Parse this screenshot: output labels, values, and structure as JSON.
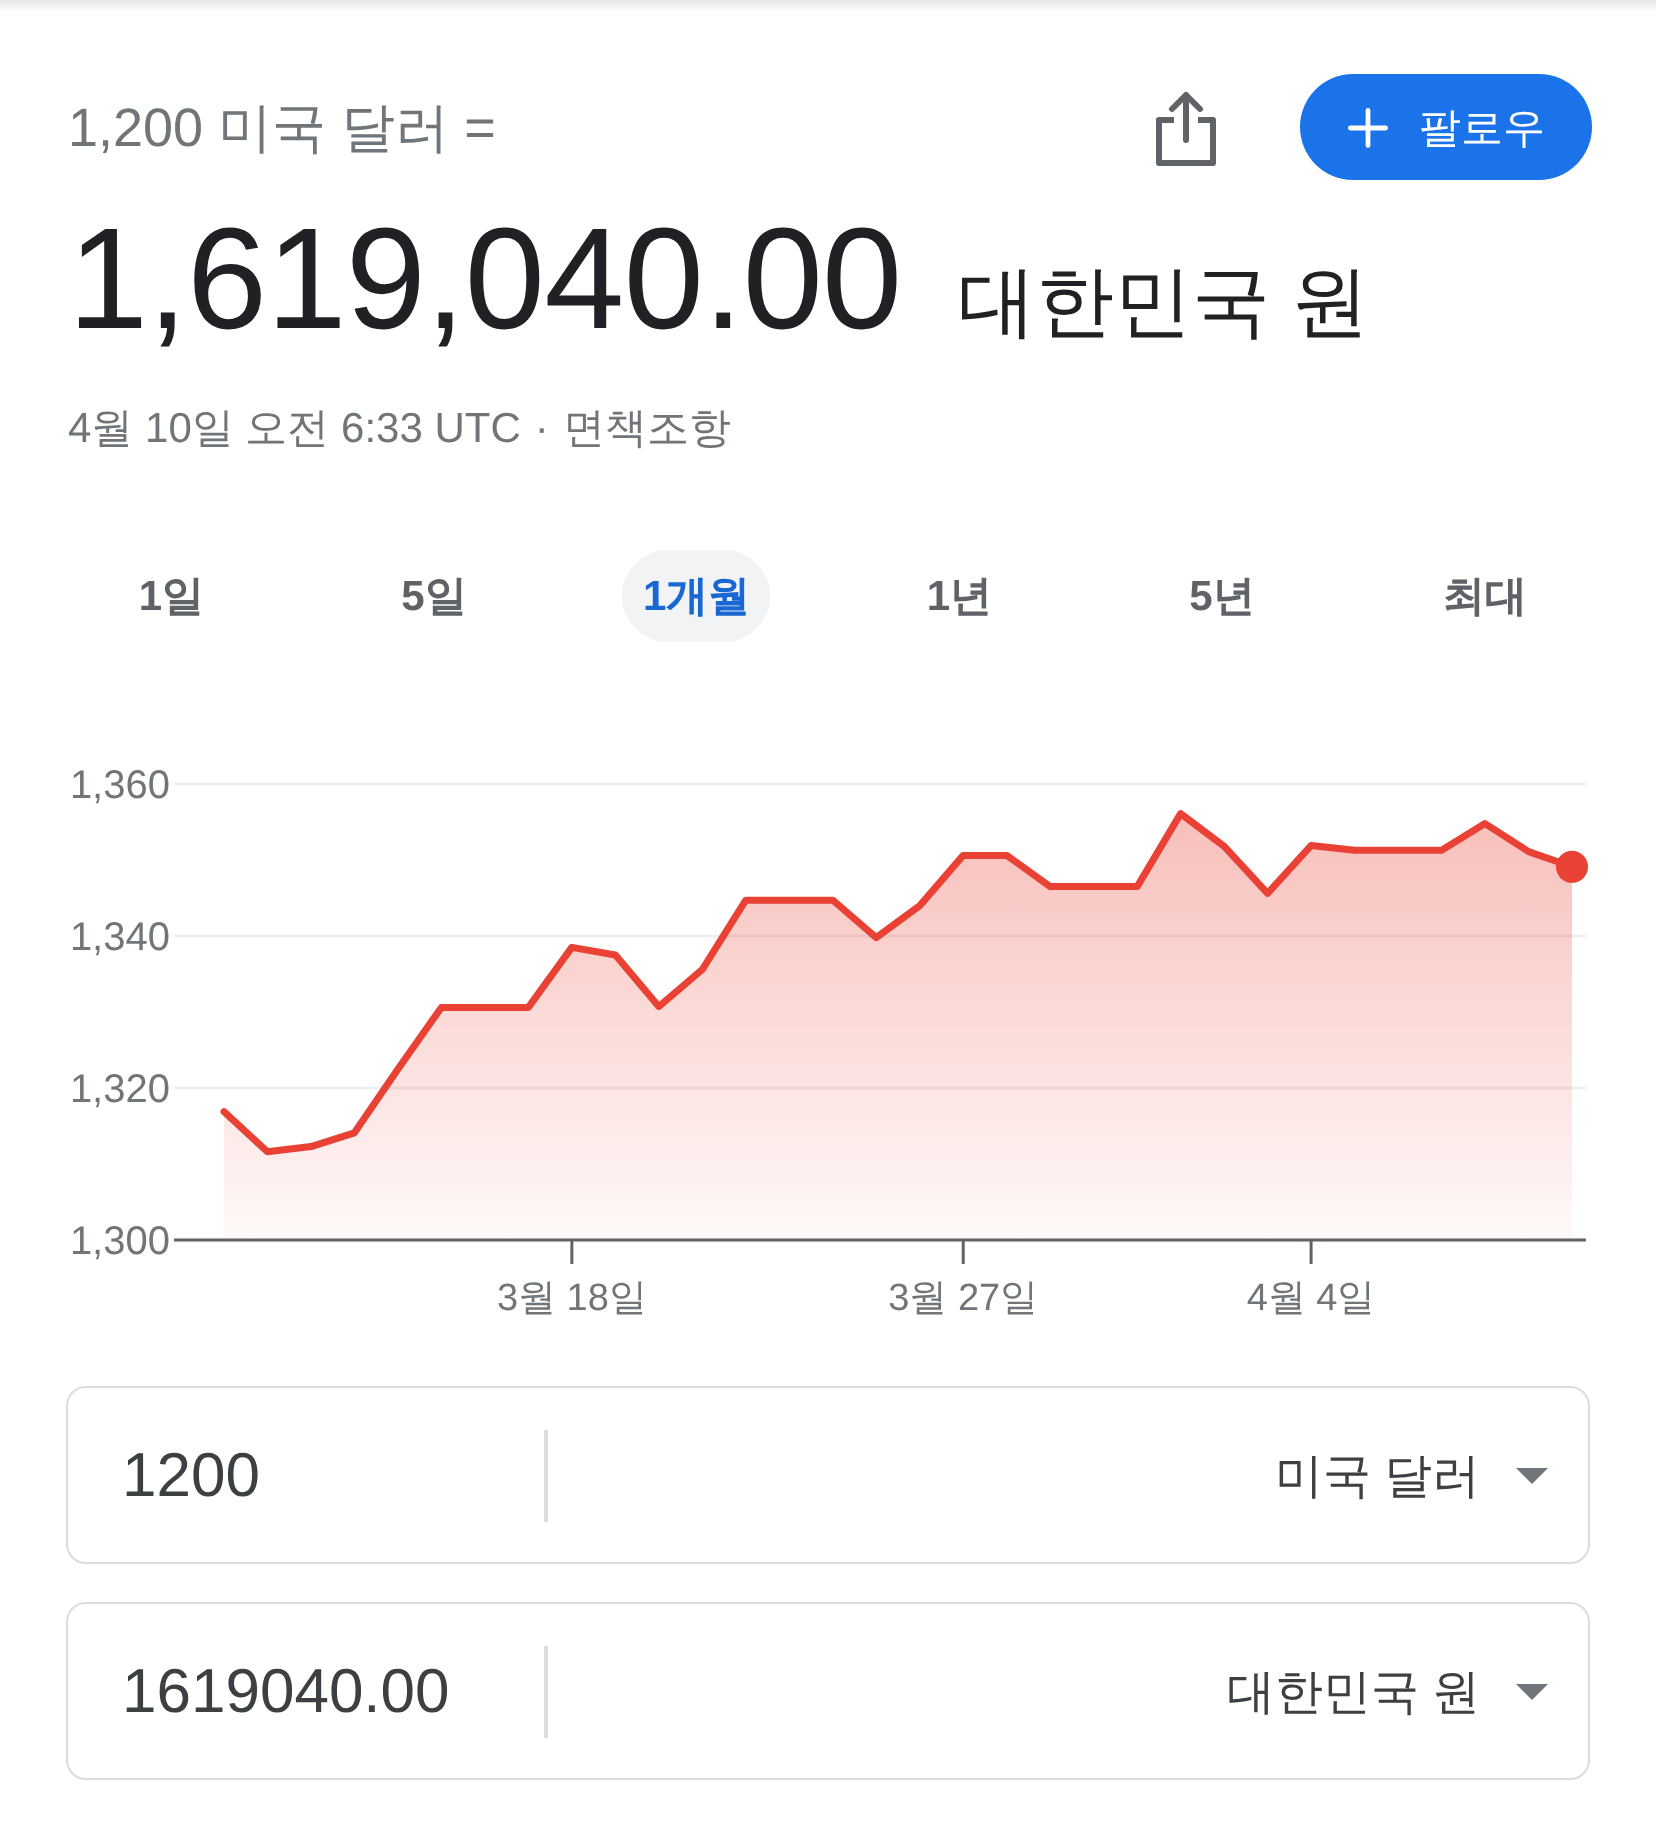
{
  "header": {
    "amount_line": "1,200 미국 달러 =",
    "follow_button": {
      "label": "팔로우"
    }
  },
  "result": {
    "value": "1,619,040.00",
    "currency": "대한민국 원"
  },
  "date_line": {
    "timestamp": "4월 10일 오전 6:33 UTC",
    "separator": "·",
    "disclaimer": "면책조항"
  },
  "range_tabs": [
    {
      "label": "1일",
      "selected": false
    },
    {
      "label": "5일",
      "selected": false
    },
    {
      "label": "1개월",
      "selected": true
    },
    {
      "label": "1년",
      "selected": false
    },
    {
      "label": "5년",
      "selected": false
    },
    {
      "label": "최대",
      "selected": false
    }
  ],
  "chart": {
    "chart_data": {
      "type": "area",
      "categories": [
        null,
        null,
        null,
        null,
        null,
        null,
        null,
        null,
        "3월 18일",
        null,
        null,
        null,
        null,
        null,
        null,
        null,
        null,
        "3월 27일",
        null,
        null,
        null,
        null,
        null,
        null,
        null,
        "4월 4일",
        null,
        null,
        null,
        null,
        null,
        null
      ],
      "ylim": [
        1300,
        1360
      ],
      "yticks": [
        {
          "value": 1300,
          "label": "1,300"
        },
        {
          "value": 1320,
          "label": "1,320"
        },
        {
          "value": 1340,
          "label": "1,340"
        },
        {
          "value": 1360,
          "label": "1,360"
        }
      ],
      "series": [
        {
          "color": "#e94235",
          "values": [
            1316.9,
            1311.6,
            1312.3,
            1314.1,
            1322.5,
            1330.6,
            1330.6,
            1330.6,
            1338.5,
            1337.5,
            1330.7,
            1335.6,
            1344.7,
            1344.7,
            1344.7,
            1339.8,
            1344.0,
            1350.6,
            1350.6,
            1346.5,
            1346.5,
            1346.5,
            1356.1,
            1351.8,
            1345.6,
            1351.9,
            1351.3,
            1351.3,
            1351.3,
            1354.8,
            1351.1,
            1349.1
          ]
        }
      ]
    }
  },
  "converter": [
    {
      "value": "1200",
      "currency": "미국 달러"
    },
    {
      "value": "1619040.00",
      "currency": "대한민국 원"
    }
  ]
}
